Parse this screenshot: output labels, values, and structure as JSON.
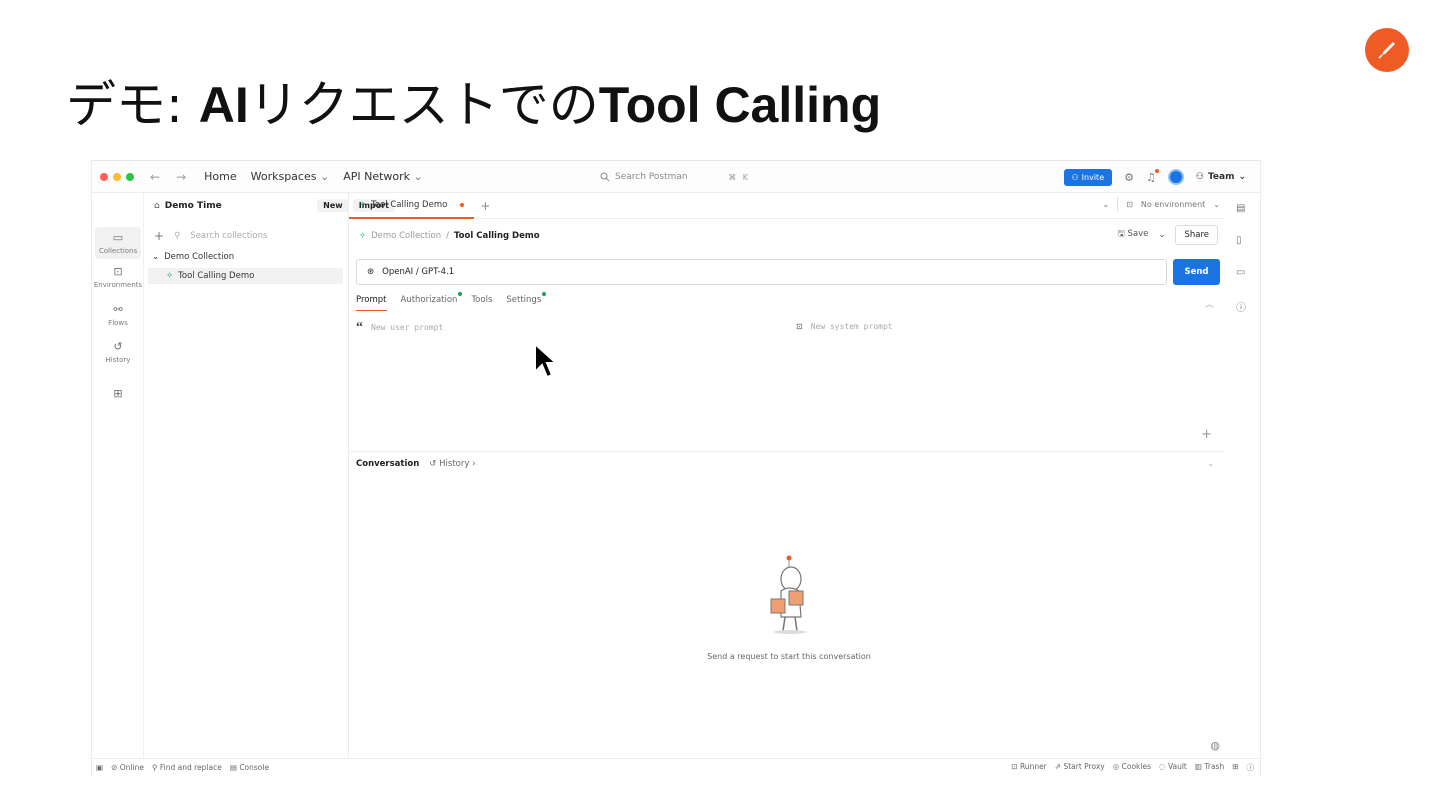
{
  "slide": {
    "title_prefix": "デモ: ",
    "title_bold_1": "AI",
    "title_middle": "リクエストでの",
    "title_bold_2": "Tool Calling"
  },
  "colors": {
    "accent": "#ef5b25",
    "primary": "#1b74e4",
    "success": "#1aa05a"
  },
  "topbar": {
    "nav": {
      "home": "Home",
      "workspaces": "Workspaces",
      "api_network": "API Network"
    },
    "search_placeholder": "Search Postman",
    "search_shortcut": "⌘ K",
    "invite_label": "Invite",
    "team_label": "Team"
  },
  "iconbar": {
    "collections": "Collections",
    "environments": "Environments",
    "flows": "Flows",
    "history": "History"
  },
  "sidebar": {
    "workspace_name": "Demo Time",
    "new_label": "New",
    "import_label": "Import",
    "search_placeholder": "Search collections",
    "collection_name": "Demo Collection",
    "request_name": "Tool Calling Demo"
  },
  "tabs": {
    "active_tab": "Tool Calling Demo",
    "environment": "No environment"
  },
  "request": {
    "breadcrumb_parent": "Demo Collection",
    "breadcrumb_separator": "/",
    "breadcrumb_current": "Tool Calling Demo",
    "save_label": "Save",
    "share_label": "Share",
    "model": "OpenAI / GPT-4.1",
    "send_label": "Send",
    "subtabs": [
      "Prompt",
      "Authorization",
      "Tools",
      "Settings"
    ],
    "user_prompt_placeholder": "New user prompt",
    "system_prompt_placeholder": "New system prompt"
  },
  "conversation": {
    "label": "Conversation",
    "history_label": "History",
    "empty_text": "Send a request to start this conversation"
  },
  "statusbar": {
    "online": "Online",
    "find_replace": "Find and replace",
    "console": "Console",
    "runner": "Runner",
    "start_proxy": "Start Proxy",
    "cookies": "Cookies",
    "vault": "Vault",
    "trash": "Trash"
  }
}
